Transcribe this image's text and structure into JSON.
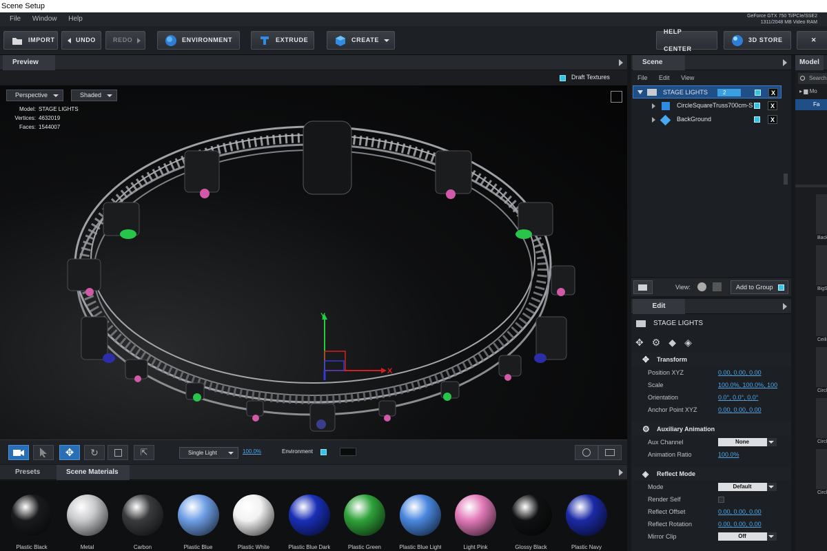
{
  "app": {
    "title": "Scene Setup",
    "menu": [
      "File",
      "Window",
      "Help"
    ],
    "gpu_line1": "GeForce GTX 750 Ti/PCIe/SSE2",
    "gpu_line2": "1311/2048 MB Video RAM"
  },
  "toolbar": {
    "import": "IMPORT",
    "undo": "UNDO",
    "redo": "REDO",
    "environment": "ENVIRONMENT",
    "extrude": "EXTRUDE",
    "create": "CREATE",
    "help": "HELP CENTER",
    "store": "3D STORE"
  },
  "preview": {
    "tab": "Preview",
    "draft_textures": "Draft Textures",
    "view_mode": "Perspective",
    "shading": "Shaded",
    "model_key": "Model:",
    "model": "STAGE LIGHTS",
    "vertices_key": "Vertices:",
    "vertices": "4632019",
    "faces_key": "Faces:",
    "faces": "1544007",
    "axis_y": "Y",
    "axis_x": "X"
  },
  "viewbar": {
    "light_mode": "Single Light",
    "light_pct": "100.0%",
    "environment": "Environment"
  },
  "bottom": {
    "tabs": [
      "Presets",
      "Scene Materials"
    ],
    "materials": [
      {
        "label": "Plastic Black",
        "color": "#1a1b1d"
      },
      {
        "label": "Metal",
        "color": "#c9cacc"
      },
      {
        "label": "Carbon",
        "color": "#3a3b3d"
      },
      {
        "label": "Plastic Blue",
        "color": "#6e9fe6"
      },
      {
        "label": "Plastic White",
        "color": "#f2f2f2"
      },
      {
        "label": "Plastic Blue Dark",
        "color": "#1a2fb8"
      },
      {
        "label": "Plastic Green",
        "color": "#2fa33a"
      },
      {
        "label": "Plastic Blue Light",
        "color": "#4a87df"
      },
      {
        "label": "Light Pink",
        "color": "#e27ab9"
      },
      {
        "label": "Glossy Black",
        "color": "#101112"
      },
      {
        "label": "Plastic Navy",
        "color": "#1b2aa6"
      }
    ]
  },
  "scene": {
    "tab": "Scene",
    "menu": [
      "File",
      "Edit",
      "View"
    ],
    "items": [
      {
        "label": "STAGE LIGHTS",
        "badge": "2"
      },
      {
        "label": "CircleSquareTruss700cm-S"
      },
      {
        "label": "BackGround"
      }
    ],
    "view_label": "View:",
    "add_group": "Add to Group"
  },
  "model": {
    "tab": "Model",
    "search_placeholder": "Search",
    "tree": [
      "Mo",
      "Fa"
    ],
    "thumbs": [
      "Back",
      "BigS",
      "Ceili",
      "Circl",
      "Circl",
      "Circl"
    ]
  },
  "edit": {
    "tab": "Edit",
    "object": "STAGE LIGHTS",
    "transform": "Transform",
    "position": "Position XYZ",
    "position_vals": [
      "0.00",
      "0.00",
      "0.00"
    ],
    "scale": "Scale",
    "scale_vals": [
      "100.0%",
      "100.0%",
      "100"
    ],
    "orientation": "Orientation",
    "orientation_vals": [
      "0.0°",
      "0.0°",
      "0.0°"
    ],
    "anchor": "Anchor Point XYZ",
    "anchor_vals": [
      "0.00",
      "0.00",
      "0.00"
    ],
    "aux_title": "Auxiliary Animation",
    "aux_channel": "Aux Channel",
    "aux_channel_val": "None",
    "anim_ratio": "Animation Ratio",
    "anim_ratio_val": "100.0%",
    "reflect_title": "Reflect Mode",
    "mode": "Mode",
    "mode_val": "Default",
    "render_self": "Render Self",
    "reflect_offset": "Reflect Offset",
    "reflect_offset_vals": [
      "0.00",
      "0.00",
      "0.00"
    ],
    "reflect_rotation": "Reflect Rotation",
    "reflect_rotation_vals": [
      "0.00",
      "0.00",
      "0.00"
    ],
    "mirror_clip": "Mirror Clip",
    "mirror_clip_val": "Off"
  }
}
